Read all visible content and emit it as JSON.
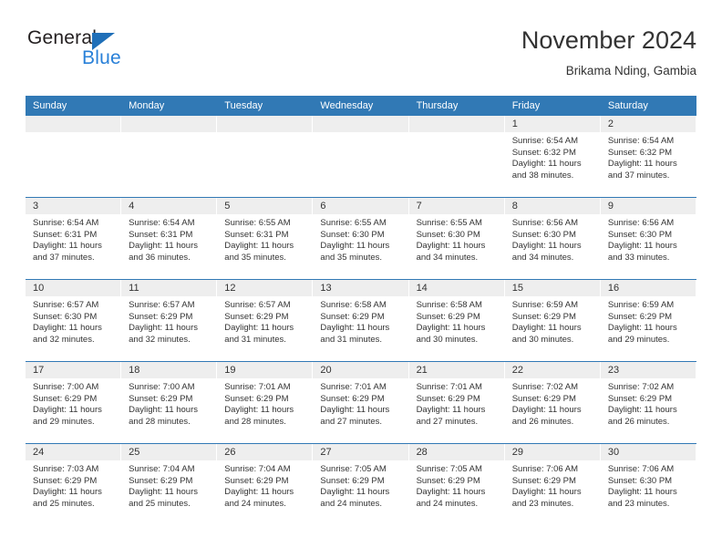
{
  "logo": {
    "word_one": "General",
    "word_two": "Blue",
    "triangle_icon": "blue-triangle-icon"
  },
  "header": {
    "title": "November 2024",
    "subtitle": "Brikama Nding, Gambia"
  },
  "colors": {
    "header_blue": "#3179b5",
    "logo_blue": "#2980d8",
    "daynum_band": "#eeeeee",
    "text": "#333333"
  },
  "calendar": {
    "weekday_headers": [
      "Sunday",
      "Monday",
      "Tuesday",
      "Wednesday",
      "Thursday",
      "Friday",
      "Saturday"
    ],
    "labels": {
      "sunrise": "Sunrise:",
      "sunset": "Sunset:",
      "daylight": "Daylight:"
    },
    "weeks": [
      [
        {
          "day": "",
          "sunrise": "",
          "sunset": "",
          "daylight": ""
        },
        {
          "day": "",
          "sunrise": "",
          "sunset": "",
          "daylight": ""
        },
        {
          "day": "",
          "sunrise": "",
          "sunset": "",
          "daylight": ""
        },
        {
          "day": "",
          "sunrise": "",
          "sunset": "",
          "daylight": ""
        },
        {
          "day": "",
          "sunrise": "",
          "sunset": "",
          "daylight": ""
        },
        {
          "day": "1",
          "sunrise": "Sunrise: 6:54 AM",
          "sunset": "Sunset: 6:32 PM",
          "daylight": "Daylight: 11 hours and 38 minutes."
        },
        {
          "day": "2",
          "sunrise": "Sunrise: 6:54 AM",
          "sunset": "Sunset: 6:32 PM",
          "daylight": "Daylight: 11 hours and 37 minutes."
        }
      ],
      [
        {
          "day": "3",
          "sunrise": "Sunrise: 6:54 AM",
          "sunset": "Sunset: 6:31 PM",
          "daylight": "Daylight: 11 hours and 37 minutes."
        },
        {
          "day": "4",
          "sunrise": "Sunrise: 6:54 AM",
          "sunset": "Sunset: 6:31 PM",
          "daylight": "Daylight: 11 hours and 36 minutes."
        },
        {
          "day": "5",
          "sunrise": "Sunrise: 6:55 AM",
          "sunset": "Sunset: 6:31 PM",
          "daylight": "Daylight: 11 hours and 35 minutes."
        },
        {
          "day": "6",
          "sunrise": "Sunrise: 6:55 AM",
          "sunset": "Sunset: 6:30 PM",
          "daylight": "Daylight: 11 hours and 35 minutes."
        },
        {
          "day": "7",
          "sunrise": "Sunrise: 6:55 AM",
          "sunset": "Sunset: 6:30 PM",
          "daylight": "Daylight: 11 hours and 34 minutes."
        },
        {
          "day": "8",
          "sunrise": "Sunrise: 6:56 AM",
          "sunset": "Sunset: 6:30 PM",
          "daylight": "Daylight: 11 hours and 34 minutes."
        },
        {
          "day": "9",
          "sunrise": "Sunrise: 6:56 AM",
          "sunset": "Sunset: 6:30 PM",
          "daylight": "Daylight: 11 hours and 33 minutes."
        }
      ],
      [
        {
          "day": "10",
          "sunrise": "Sunrise: 6:57 AM",
          "sunset": "Sunset: 6:30 PM",
          "daylight": "Daylight: 11 hours and 32 minutes."
        },
        {
          "day": "11",
          "sunrise": "Sunrise: 6:57 AM",
          "sunset": "Sunset: 6:29 PM",
          "daylight": "Daylight: 11 hours and 32 minutes."
        },
        {
          "day": "12",
          "sunrise": "Sunrise: 6:57 AM",
          "sunset": "Sunset: 6:29 PM",
          "daylight": "Daylight: 11 hours and 31 minutes."
        },
        {
          "day": "13",
          "sunrise": "Sunrise: 6:58 AM",
          "sunset": "Sunset: 6:29 PM",
          "daylight": "Daylight: 11 hours and 31 minutes."
        },
        {
          "day": "14",
          "sunrise": "Sunrise: 6:58 AM",
          "sunset": "Sunset: 6:29 PM",
          "daylight": "Daylight: 11 hours and 30 minutes."
        },
        {
          "day": "15",
          "sunrise": "Sunrise: 6:59 AM",
          "sunset": "Sunset: 6:29 PM",
          "daylight": "Daylight: 11 hours and 30 minutes."
        },
        {
          "day": "16",
          "sunrise": "Sunrise: 6:59 AM",
          "sunset": "Sunset: 6:29 PM",
          "daylight": "Daylight: 11 hours and 29 minutes."
        }
      ],
      [
        {
          "day": "17",
          "sunrise": "Sunrise: 7:00 AM",
          "sunset": "Sunset: 6:29 PM",
          "daylight": "Daylight: 11 hours and 29 minutes."
        },
        {
          "day": "18",
          "sunrise": "Sunrise: 7:00 AM",
          "sunset": "Sunset: 6:29 PM",
          "daylight": "Daylight: 11 hours and 28 minutes."
        },
        {
          "day": "19",
          "sunrise": "Sunrise: 7:01 AM",
          "sunset": "Sunset: 6:29 PM",
          "daylight": "Daylight: 11 hours and 28 minutes."
        },
        {
          "day": "20",
          "sunrise": "Sunrise: 7:01 AM",
          "sunset": "Sunset: 6:29 PM",
          "daylight": "Daylight: 11 hours and 27 minutes."
        },
        {
          "day": "21",
          "sunrise": "Sunrise: 7:01 AM",
          "sunset": "Sunset: 6:29 PM",
          "daylight": "Daylight: 11 hours and 27 minutes."
        },
        {
          "day": "22",
          "sunrise": "Sunrise: 7:02 AM",
          "sunset": "Sunset: 6:29 PM",
          "daylight": "Daylight: 11 hours and 26 minutes."
        },
        {
          "day": "23",
          "sunrise": "Sunrise: 7:02 AM",
          "sunset": "Sunset: 6:29 PM",
          "daylight": "Daylight: 11 hours and 26 minutes."
        }
      ],
      [
        {
          "day": "24",
          "sunrise": "Sunrise: 7:03 AM",
          "sunset": "Sunset: 6:29 PM",
          "daylight": "Daylight: 11 hours and 25 minutes."
        },
        {
          "day": "25",
          "sunrise": "Sunrise: 7:04 AM",
          "sunset": "Sunset: 6:29 PM",
          "daylight": "Daylight: 11 hours and 25 minutes."
        },
        {
          "day": "26",
          "sunrise": "Sunrise: 7:04 AM",
          "sunset": "Sunset: 6:29 PM",
          "daylight": "Daylight: 11 hours and 24 minutes."
        },
        {
          "day": "27",
          "sunrise": "Sunrise: 7:05 AM",
          "sunset": "Sunset: 6:29 PM",
          "daylight": "Daylight: 11 hours and 24 minutes."
        },
        {
          "day": "28",
          "sunrise": "Sunrise: 7:05 AM",
          "sunset": "Sunset: 6:29 PM",
          "daylight": "Daylight: 11 hours and 24 minutes."
        },
        {
          "day": "29",
          "sunrise": "Sunrise: 7:06 AM",
          "sunset": "Sunset: 6:29 PM",
          "daylight": "Daylight: 11 hours and 23 minutes."
        },
        {
          "day": "30",
          "sunrise": "Sunrise: 7:06 AM",
          "sunset": "Sunset: 6:30 PM",
          "daylight": "Daylight: 11 hours and 23 minutes."
        }
      ]
    ]
  }
}
